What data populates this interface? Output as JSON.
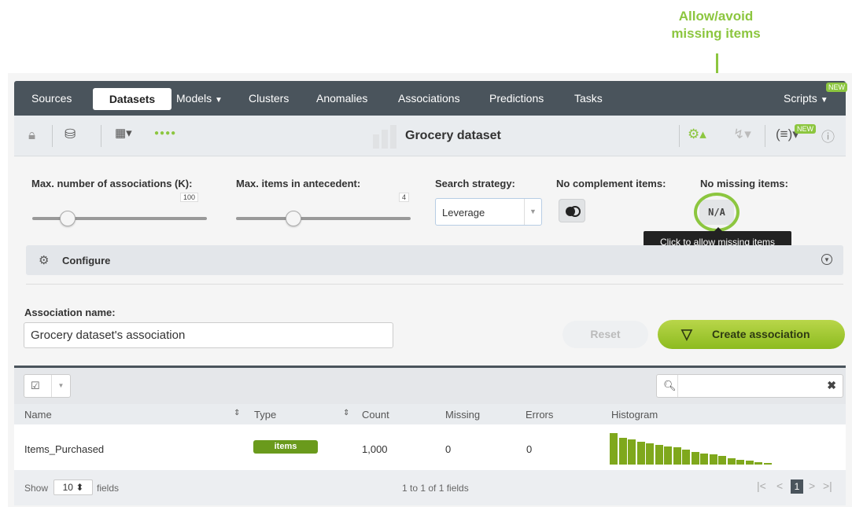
{
  "annotation": {
    "line1": "Allow/avoid",
    "line2": "missing items"
  },
  "nav": {
    "items": [
      "Sources",
      "Datasets",
      "Models",
      "Clusters",
      "Anomalies",
      "Associations",
      "Predictions",
      "Tasks",
      "Scripts"
    ],
    "new_badge": "NEW"
  },
  "toolbar": {
    "title": "Grocery dataset",
    "new_badge": "NEW"
  },
  "params": {
    "max_assoc_label": "Max. number of associations (K):",
    "max_assoc_value": "100",
    "max_items_label": "Max. items in antecedent:",
    "max_items_value": "4",
    "strategy_label": "Search strategy:",
    "strategy_value": "Leverage",
    "complement_label": "No complement items:",
    "missing_label": "No missing items:",
    "missing_button": "N/A",
    "tooltip": "Click to allow missing items"
  },
  "configure": {
    "label": "Configure"
  },
  "form": {
    "name_label": "Association name:",
    "name_value": "Grocery dataset's association",
    "reset": "Reset",
    "create": "Create association"
  },
  "table": {
    "columns": [
      "Name",
      "Type",
      "Count",
      "Missing",
      "Errors",
      "Histogram"
    ],
    "rows": [
      {
        "name": "Items_Purchased",
        "type": "items",
        "count": "1,000",
        "missing": "0",
        "errors": "0"
      }
    ],
    "histogram_relative": [
      1.0,
      0.85,
      0.8,
      0.72,
      0.68,
      0.62,
      0.58,
      0.55,
      0.48,
      0.4,
      0.36,
      0.32,
      0.28,
      0.2,
      0.16,
      0.12,
      0.08,
      0.06
    ]
  },
  "footer": {
    "show": "Show",
    "count": "10",
    "fields": "fields",
    "range": "1 to 1 of 1 fields",
    "page": "1"
  },
  "colors": {
    "accent": "#8cc63f",
    "nav_bg": "#4a545c",
    "histogram": "#7fa81c"
  }
}
